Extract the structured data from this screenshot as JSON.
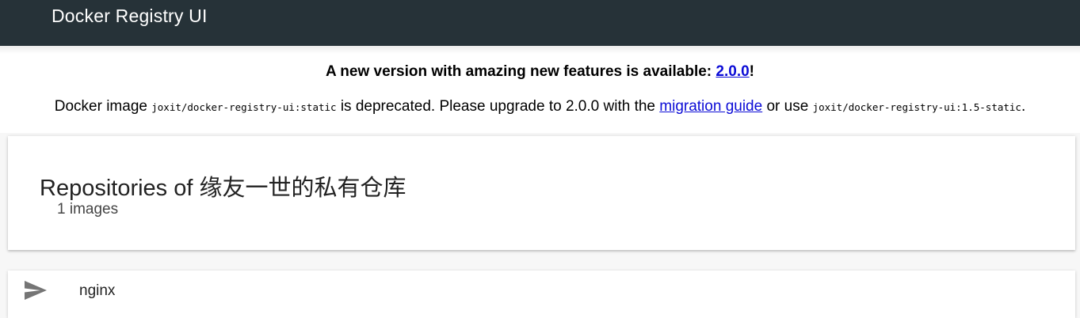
{
  "app": {
    "title": "Docker Registry UI"
  },
  "banner": {
    "headline_prefix": "A new version with amazing new features is available: ",
    "headline_link": "2.0.0",
    "headline_suffix": "!",
    "note_part1": "Docker image ",
    "note_image_old": "joxit/docker-registry-ui:static",
    "note_part2": " is deprecated. Please upgrade to 2.0.0 with the ",
    "note_link": "migration guide",
    "note_part3": " or use ",
    "note_image_new": "joxit/docker-registry-ui:1.5-static",
    "note_part4": "."
  },
  "header_card": {
    "title": "Repositories of 缘友一世的私有仓库",
    "subtitle": "1 images"
  },
  "repositories": [
    {
      "name": "nginx",
      "icon": "send-icon"
    }
  ],
  "colors": {
    "app_bar": "#263238",
    "link": "#0b0bd6",
    "icon": "#757575"
  }
}
